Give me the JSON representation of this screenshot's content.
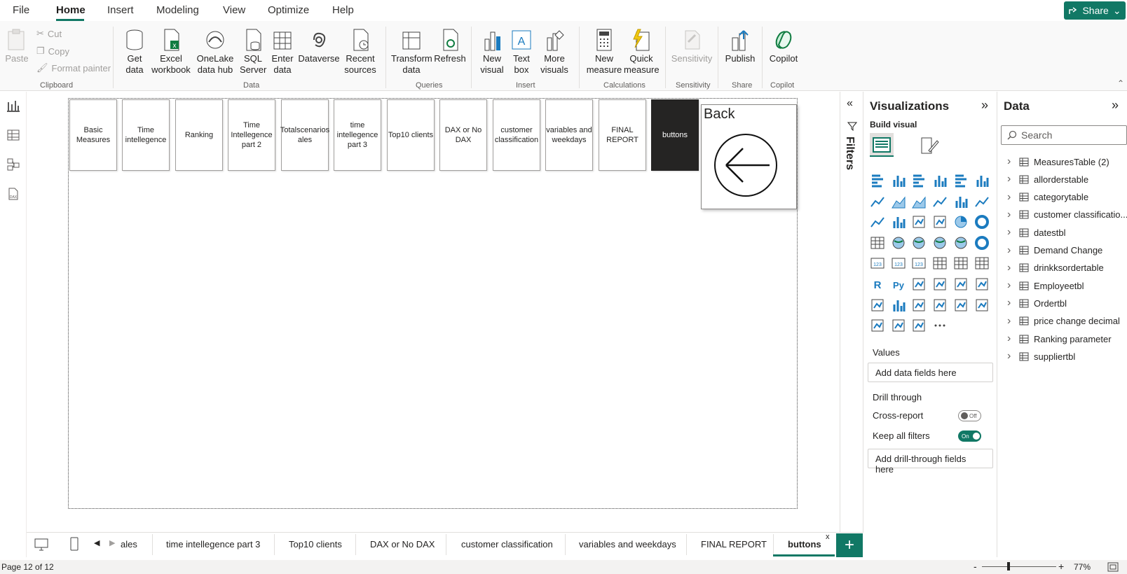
{
  "menu": {
    "items": [
      "File",
      "Home",
      "Insert",
      "Modeling",
      "View",
      "Optimize",
      "Help"
    ],
    "share": "Share"
  },
  "ribbon": {
    "clipboard": {
      "paste": "Paste",
      "cut": "Cut",
      "copy": "Copy",
      "format_painter": "Format painter",
      "label": "Clipboard"
    },
    "data": {
      "get_data": "Get data",
      "excel": "Excel workbook",
      "onelake": "OneLake data hub",
      "sql": "SQL Server",
      "enter": "Enter data",
      "dataverse": "Dataverse",
      "recent": "Recent sources",
      "label": "Data"
    },
    "queries": {
      "transform": "Transform data",
      "refresh": "Refresh",
      "label": "Queries"
    },
    "insert": {
      "new_visual": "New visual",
      "text_box": "Text box",
      "more_visuals": "More visuals",
      "label": "Insert"
    },
    "calculations": {
      "new_measure": "New measure",
      "quick_measure": "Quick measure",
      "label": "Calculations"
    },
    "sensitivity": {
      "sensitivity": "Sensitivity",
      "label": "Sensitivity"
    },
    "share": {
      "publish": "Publish",
      "label": "Share"
    },
    "copilot": {
      "copilot": "Copilot",
      "label": "Copilot"
    }
  },
  "canvas": {
    "nav_buttons": [
      "Basic Measures",
      "Time intellegence",
      "Ranking",
      "Time Intellegence part 2",
      "Totalscenarios ales",
      "time intellegence part 3",
      "Top10 clients",
      "DAX or No DAX",
      "customer classification",
      "variables and weekdays",
      "FINAL REPORT",
      "buttons"
    ],
    "back_label": "Back"
  },
  "filters": {
    "title": "Filters"
  },
  "visualizations": {
    "title": "Visualizations",
    "build_visual": "Build visual",
    "values_label": "Values",
    "values_placeholder": "Add data fields here",
    "drill_through": "Drill through",
    "cross_report": "Cross-report",
    "cross_report_state": "Off",
    "keep_all_filters": "Keep all filters",
    "keep_all_filters_state": "On",
    "drill_placeholder": "Add drill-through fields here"
  },
  "data_pane": {
    "title": "Data",
    "search_placeholder": "Search",
    "tables": [
      "MeasuresTable (2)",
      "allorderstable",
      "categorytable",
      "customer classificatio...",
      "datestbl",
      "Demand Change",
      "drinkksordertable",
      "Employeetbl",
      "Ordertbl",
      "price change decimal",
      "Ranking parameter",
      "suppliertbl"
    ]
  },
  "tabs": {
    "items": [
      "ales",
      "time intellegence part 3",
      "Top10 clients",
      "DAX or No DAX",
      "customer classification",
      "variables and weekdays",
      "FINAL REPORT",
      "buttons"
    ],
    "close": "x",
    "add": "+"
  },
  "status": {
    "page": "Page 12 of 12",
    "zoom": "77%",
    "zoom_minus": "-",
    "zoom_plus": "+"
  },
  "colors": {
    "accent": "#117865",
    "active_button": "#252423"
  }
}
